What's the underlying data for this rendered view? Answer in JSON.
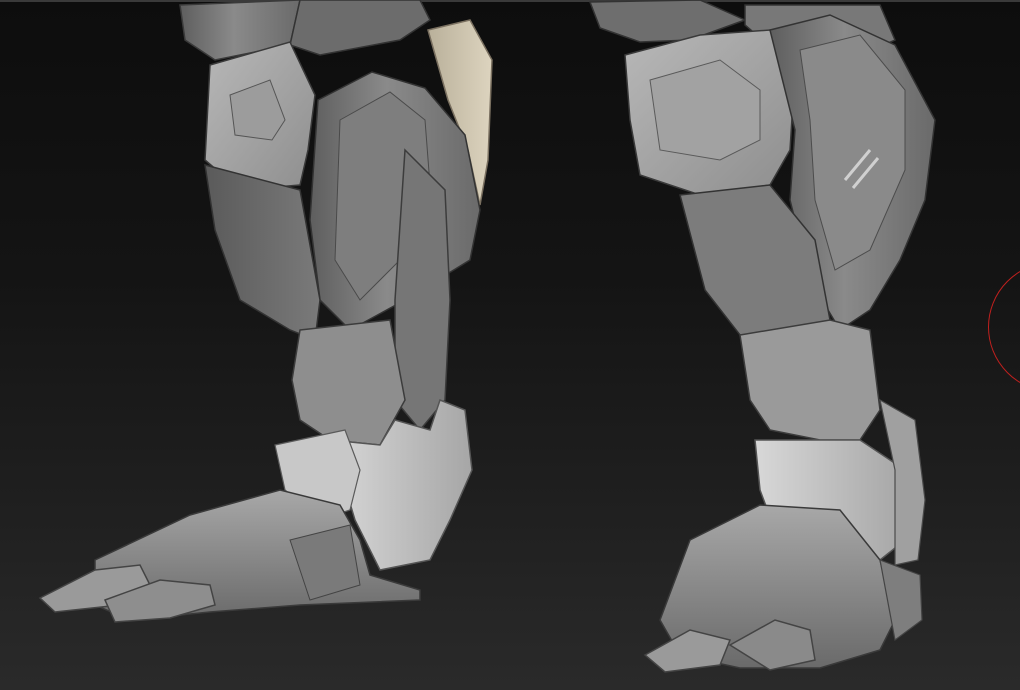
{
  "viewport": {
    "background_top": "#0d0d0d",
    "background_bottom": "#2a2a2a",
    "model_color": "#8c8c8c",
    "highlight_color": "#c4c4c4",
    "selected_part_color": "#cfc6b0",
    "brush_cursor_color": "#c0201e"
  },
  "icons": {
    "brush": "brush-cursor-icon"
  }
}
